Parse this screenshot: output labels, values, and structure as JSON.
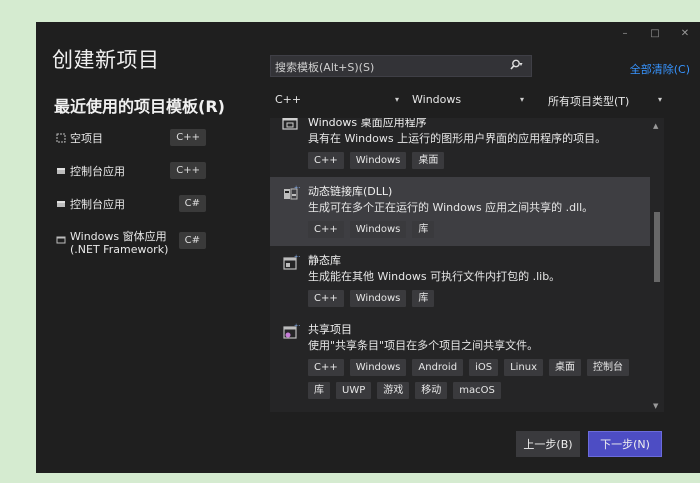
{
  "window": {
    "controls": {
      "minimize": "–",
      "maximize": "□",
      "close": "✕"
    }
  },
  "title": "创建新项目",
  "recent": {
    "title": "最近使用的项目模板(R)",
    "items": [
      {
        "icon": "empty-project-icon",
        "label": "空项目",
        "badge": "C++"
      },
      {
        "icon": "console-app-icon",
        "label": "控制台应用",
        "badge": "C++"
      },
      {
        "icon": "console-app-icon",
        "label": "控制台应用",
        "badge": "C#"
      },
      {
        "icon": "windows-forms-icon",
        "label": "Windows 窗体应用",
        "label2": "(.NET Framework)",
        "badge": "C#"
      }
    ]
  },
  "search": {
    "placeholder": "搜索模板(Alt+S)(S)",
    "icon": "search-icon",
    "chevron": "▾"
  },
  "clear_all": "全部清除(C)",
  "filters": {
    "language": "C++",
    "platform": "Windows",
    "project_type": "所有项目类型(T)"
  },
  "templates": [
    {
      "name": "Windows 桌面应用程序",
      "description": "具有在 Windows 上运行的图形用户界面的应用程序的项目。",
      "tags": [
        "C++",
        "Windows",
        "桌面"
      ],
      "icon": "desktop-app-icon"
    },
    {
      "name": "动态链接库(DLL)",
      "description": "生成可在多个正在运行的 Windows 应用之间共享的 .dll。",
      "tags": [
        "C++",
        "Windows",
        "库"
      ],
      "icon": "dll-icon",
      "selected": true
    },
    {
      "name": "静态库",
      "description": "生成能在其他 Windows 可执行文件内打包的 .lib。",
      "tags": [
        "C++",
        "Windows",
        "库"
      ],
      "icon": "static-lib-icon"
    },
    {
      "name": "共享项目",
      "description": "使用\"共享条目\"项目在多个项目之间共享文件。",
      "tags": [
        "C++",
        "Windows",
        "Android",
        "iOS",
        "Linux",
        "桌面",
        "控制台",
        "库",
        "UWP",
        "游戏",
        "移动",
        "macOS"
      ],
      "icon": "shared-project-icon"
    }
  ],
  "buttons": {
    "back": "上一步(B)",
    "next": "下一步(N)"
  },
  "colors": {
    "accent": "#4d4dc4",
    "link": "#3794ff",
    "background": "#1f1f1f"
  }
}
